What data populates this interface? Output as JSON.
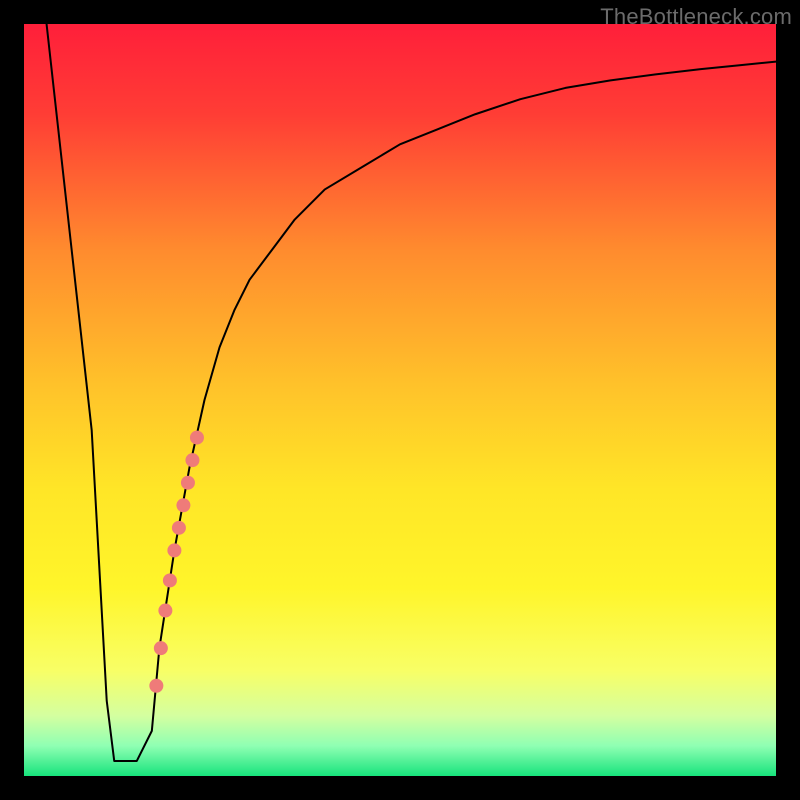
{
  "watermark": "TheBottleneck.com",
  "chart_data": {
    "type": "line",
    "title": "",
    "xlabel": "",
    "ylabel": "",
    "xlim": [
      0,
      100
    ],
    "ylim": [
      0,
      100
    ],
    "grid": false,
    "legend": false,
    "background_gradient": {
      "stops": [
        {
          "offset": 0.0,
          "color": "#ff1f3a"
        },
        {
          "offset": 0.12,
          "color": "#ff3d35"
        },
        {
          "offset": 0.3,
          "color": "#ff8b2e"
        },
        {
          "offset": 0.48,
          "color": "#ffc22a"
        },
        {
          "offset": 0.62,
          "color": "#ffe627"
        },
        {
          "offset": 0.75,
          "color": "#fff52a"
        },
        {
          "offset": 0.86,
          "color": "#f8ff66"
        },
        {
          "offset": 0.92,
          "color": "#d4ffa0"
        },
        {
          "offset": 0.96,
          "color": "#8fffb3"
        },
        {
          "offset": 1.0,
          "color": "#17e37c"
        }
      ]
    },
    "series": [
      {
        "name": "bottleneck-curve",
        "color": "#000000",
        "width": 2,
        "x": [
          3,
          5,
          7,
          9,
          10,
          11,
          12,
          13,
          15,
          17,
          18,
          20,
          22,
          24,
          26,
          28,
          30,
          33,
          36,
          40,
          45,
          50,
          55,
          60,
          66,
          72,
          78,
          84,
          90,
          95,
          100
        ],
        "y": [
          100,
          82,
          64,
          46,
          28,
          10,
          2,
          2,
          2,
          6,
          17,
          30,
          41,
          50,
          57,
          62,
          66,
          70,
          74,
          78,
          81,
          84,
          86,
          88,
          90,
          91.5,
          92.5,
          93.3,
          94,
          94.5,
          95
        ]
      }
    ],
    "scatter": [
      {
        "name": "highlight-dots",
        "color": "#ef7b79",
        "radius": 7,
        "points": [
          {
            "x": 17.6,
            "y": 12
          },
          {
            "x": 18.2,
            "y": 17
          },
          {
            "x": 18.8,
            "y": 22
          },
          {
            "x": 19.4,
            "y": 26
          },
          {
            "x": 20.0,
            "y": 30
          },
          {
            "x": 20.6,
            "y": 33
          },
          {
            "x": 21.2,
            "y": 36
          },
          {
            "x": 21.8,
            "y": 39
          },
          {
            "x": 22.4,
            "y": 42
          },
          {
            "x": 23.0,
            "y": 45
          }
        ]
      }
    ]
  }
}
